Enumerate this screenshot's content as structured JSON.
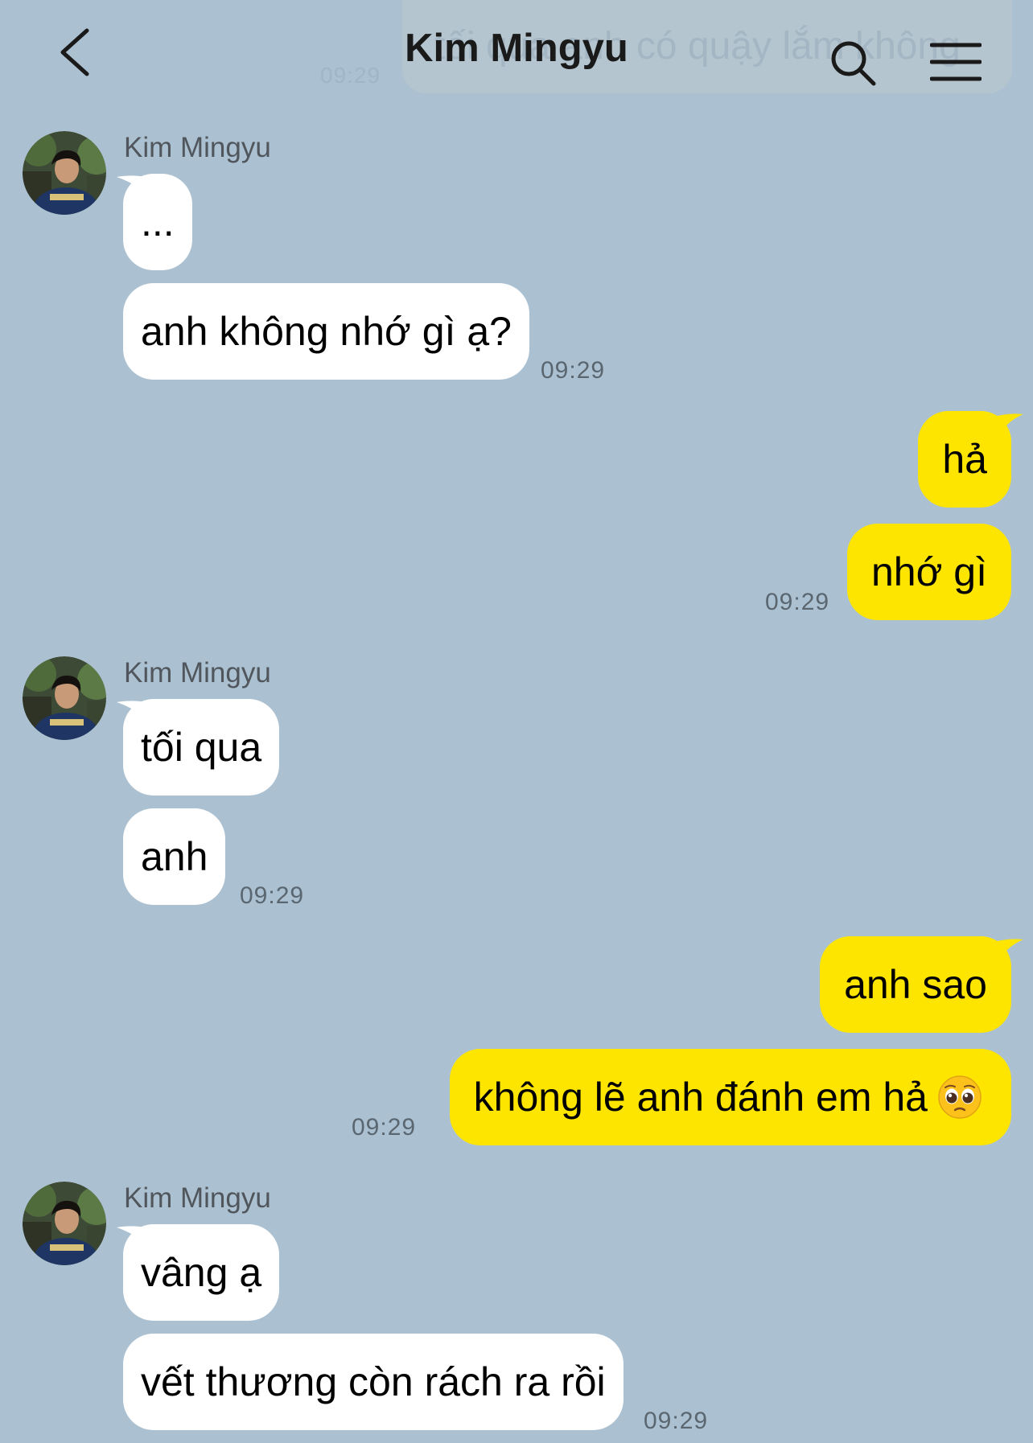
{
  "header": {
    "title": "Kim Mingyu",
    "ghost_text": "tối qua anh có quậy lắm không",
    "ghost_time": "09:29"
  },
  "groups": [
    {
      "sender": "Kim Mingyu",
      "messages": [
        "...",
        "anh không nhớ gì ạ?"
      ],
      "time": "09:29"
    },
    {
      "messages": [
        "hả",
        "nhớ gì"
      ],
      "time": "09:29"
    },
    {
      "sender": "Kim Mingyu",
      "messages": [
        "tối qua",
        "anh"
      ],
      "time": "09:29"
    },
    {
      "messages": [
        "anh sao",
        "không lẽ anh đánh em hả"
      ],
      "emoji": "pleading-face-emoji",
      "time": "09:29"
    },
    {
      "sender": "Kim Mingyu",
      "messages": [
        "vâng ạ",
        "vết thương còn rách ra rồi"
      ],
      "time": "09:29"
    }
  ],
  "colors": {
    "background": "#abc1d1",
    "incoming_bubble": "#ffffff",
    "outgoing_bubble": "#fee500"
  }
}
